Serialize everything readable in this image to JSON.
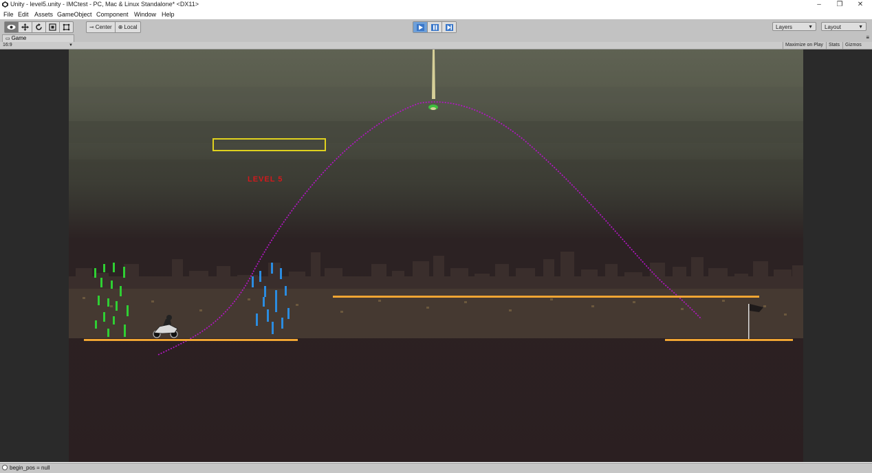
{
  "window": {
    "title": "Unity - level5.unity - IMCtest - PC, Mac & Linux Standalone* <DX11>",
    "minimize_glyph": "–",
    "maximize_glyph": "❐",
    "close_glyph": "✕"
  },
  "menu": [
    {
      "label": "File"
    },
    {
      "label": "Edit"
    },
    {
      "label": "Assets"
    },
    {
      "label": "GameObject"
    },
    {
      "label": "Component"
    },
    {
      "label": "Window"
    },
    {
      "label": "Help"
    }
  ],
  "toolbar": {
    "tools": [
      "hand-tool-icon",
      "move-tool-icon",
      "rotate-tool-icon",
      "scale-tool-icon",
      "rect-tool-icon"
    ],
    "pivot_label": "Center",
    "handle_label": "Local",
    "play_state": "playing",
    "layers_label": "Layers",
    "layout_label": "Layout"
  },
  "game_view": {
    "tab_label": "Game",
    "aspect_label": "16:9",
    "maximize_label": "Maximize on Play",
    "stats_label": "Stats",
    "gizmos_label": "Gizmos"
  },
  "scene": {
    "level_label": "LEVEL 5",
    "colors": {
      "sky_top": "#5e6152",
      "sky_mid": "#3d3f35",
      "night": "#2b1f20",
      "ground_line": "#f0a533",
      "trajectory": "#b316c4",
      "score_box": "#e0d21e",
      "level_text": "#d3191c",
      "green_obstacles": "#2fcf33",
      "blue_obstacles": "#2b8ce0"
    }
  },
  "status_bar": {
    "message": "begin_pos = null"
  }
}
